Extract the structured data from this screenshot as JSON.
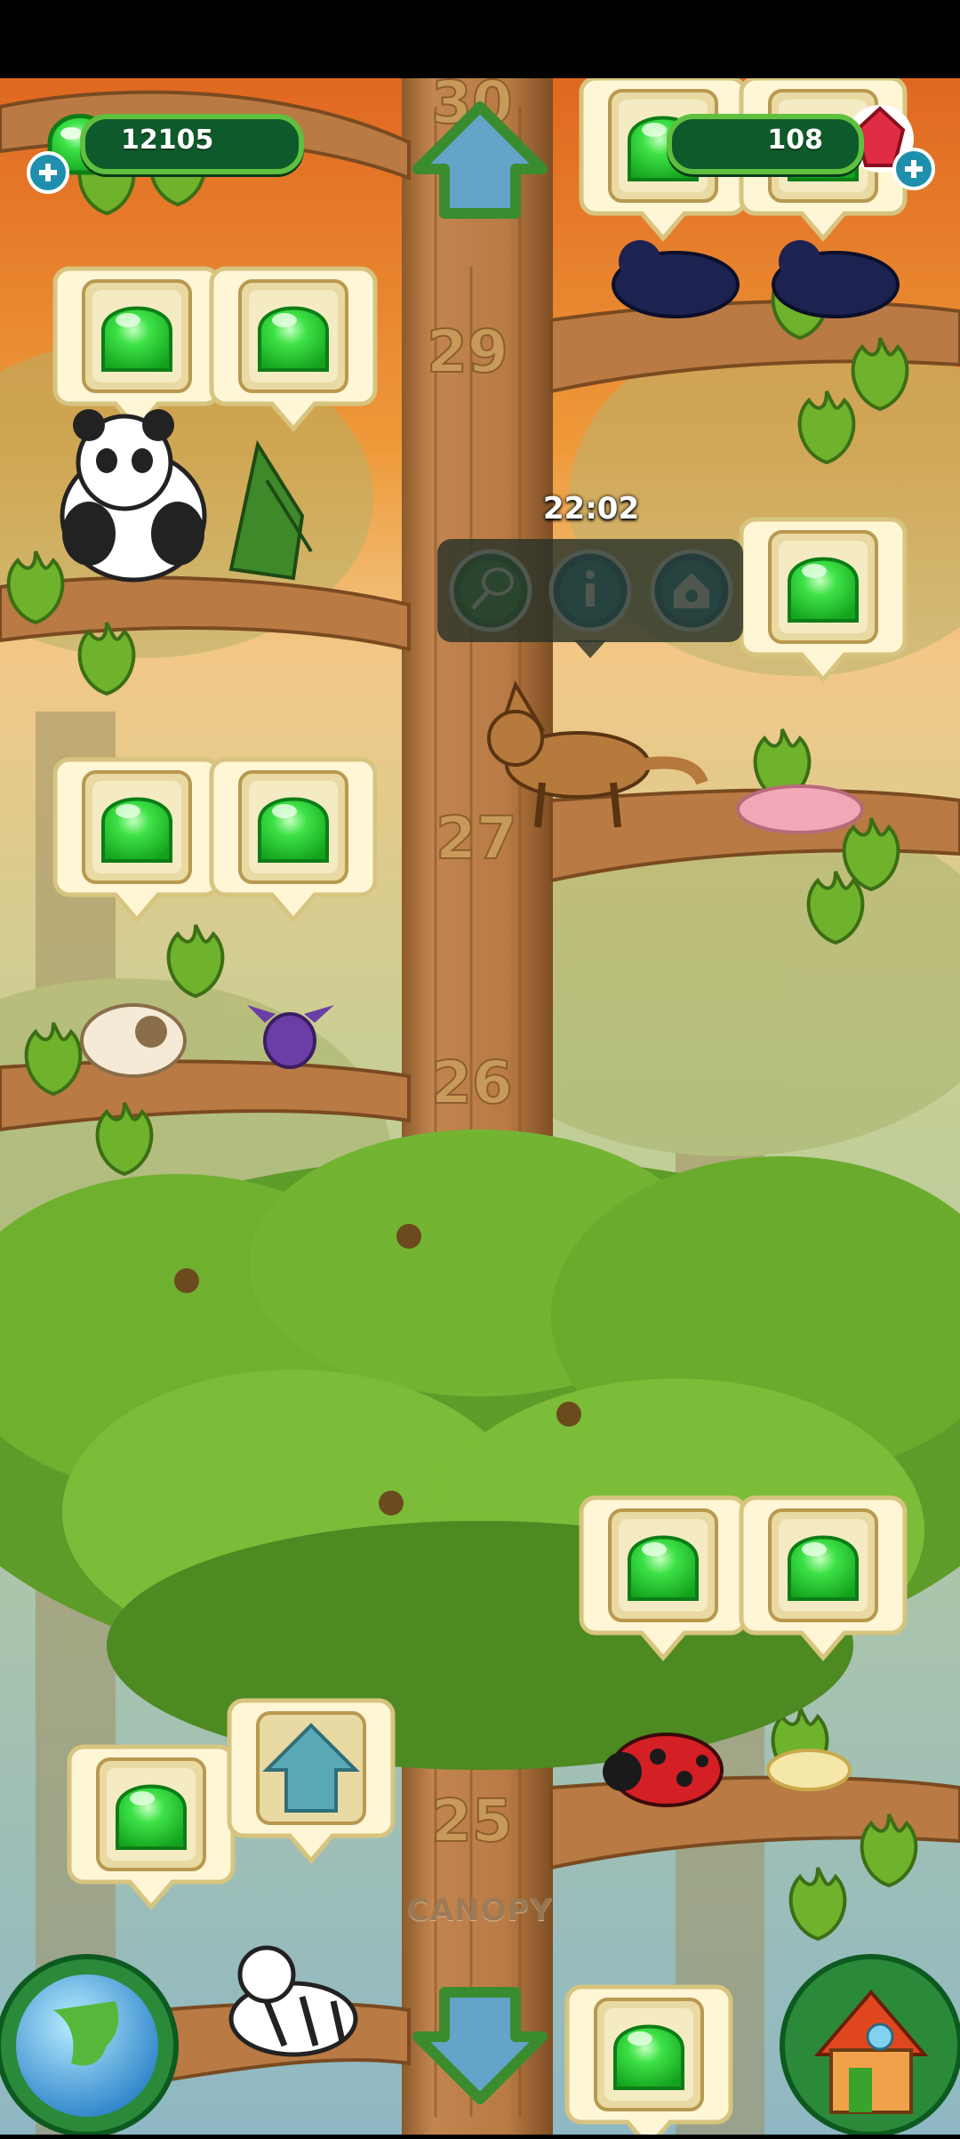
{
  "hud": {
    "left_currency": {
      "name": "jelly",
      "value": "12105",
      "icon": "green-jelly-icon",
      "add_icon": "plus-icon"
    },
    "right_currency": {
      "name": "gems",
      "value": "108",
      "icon": "red-gem-icon",
      "add_icon": "plus-icon"
    }
  },
  "tree": {
    "floors": [
      "30",
      "29",
      "27",
      "26",
      "25"
    ],
    "section_label": "CANOPY"
  },
  "selected_habitat": {
    "timer": "22:02",
    "actions": [
      {
        "name": "net-button",
        "icon": "butterfly-net-icon"
      },
      {
        "name": "info-button",
        "icon": "info-icon"
      },
      {
        "name": "habitat-button",
        "icon": "animal-house-icon"
      }
    ]
  },
  "navigation": {
    "scroll_up_icon": "up-arrow-icon",
    "scroll_down_icon": "down-arrow-icon",
    "map_button_icon": "globe-icon",
    "home_button_icon": "house-icon"
  },
  "animals": [
    "panda",
    "pterodactyl",
    "black-birds",
    "coyote",
    "naked-mole-rat",
    "sheep",
    "purple-bat",
    "ladybug",
    "fish",
    "zebra"
  ],
  "colors": {
    "jelly": "#2fd13a",
    "trunk": "#b77a44",
    "sky": "#e8762a",
    "leaf": "#6bb230",
    "hud_bg": "#0e5a2a",
    "button_teal": "#1f8fae"
  }
}
